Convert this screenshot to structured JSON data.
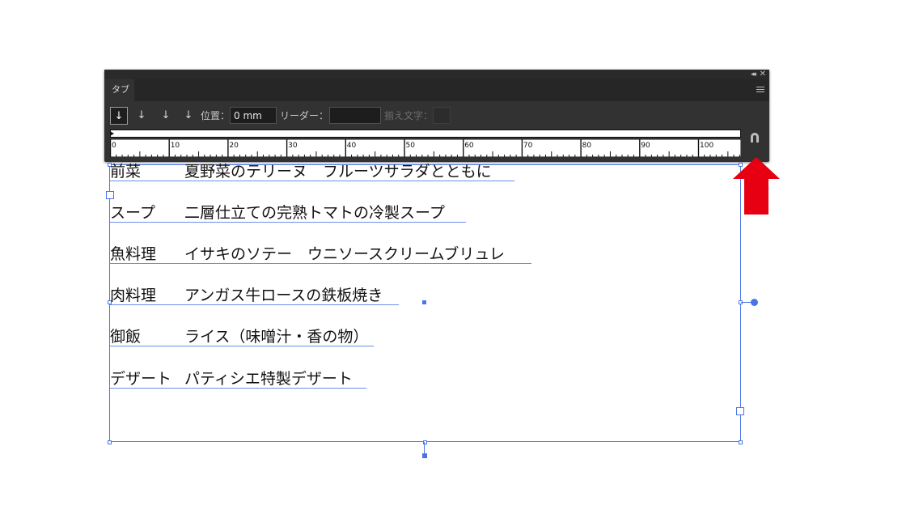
{
  "panel": {
    "title_tab": "タブ",
    "collapse_icon": "double-chevron-left-icon",
    "close_icon": "close-icon",
    "menu_icon": "hamburger-menu-icon",
    "toolbar": {
      "buttons": [
        {
          "icon": "left-justified-tab-icon",
          "glyph": "↓",
          "active": true
        },
        {
          "icon": "center-justified-tab-icon",
          "glyph": "↓",
          "active": false
        },
        {
          "icon": "right-justified-tab-icon",
          "glyph": "↓",
          "active": false
        },
        {
          "icon": "decimal-justified-tab-icon",
          "glyph": "↓",
          "active": false
        }
      ],
      "position_label": "位置：",
      "position_value": "0 mm",
      "leader_label": "リーダー：",
      "leader_value": "",
      "align_on_label": "揃え文字：",
      "align_on_value": ""
    },
    "ruler": {
      "unit": "mm",
      "labels": [
        "0",
        "10",
        "20",
        "30",
        "40",
        "50",
        "60",
        "70",
        "80",
        "90",
        "100"
      ]
    },
    "magnet_icon": "magnet-snap-icon"
  },
  "menu_items": [
    {
      "course": "前菜",
      "dish": "夏野菜のテリーヌ　フルーツサラダとともに"
    },
    {
      "course": "スープ",
      "dish": "二層仕立ての完熟トマトの冷製スープ"
    },
    {
      "course": "魚料理",
      "dish": "イサキのソテー　ウニソースクリームブリュレ"
    },
    {
      "course": "肉料理",
      "dish": "アンガス牛ロースの鉄板焼き"
    },
    {
      "course": "御飯",
      "dish": "ライス（味噌汁・香の物）"
    },
    {
      "course": "デザート",
      "dish": "パティシエ特製デザート"
    }
  ],
  "annotation": {
    "icon": "red-arrow-up-icon",
    "color": "#e60012"
  },
  "colors": {
    "panel_bg": "#323232",
    "selection": "#4a74e8"
  }
}
